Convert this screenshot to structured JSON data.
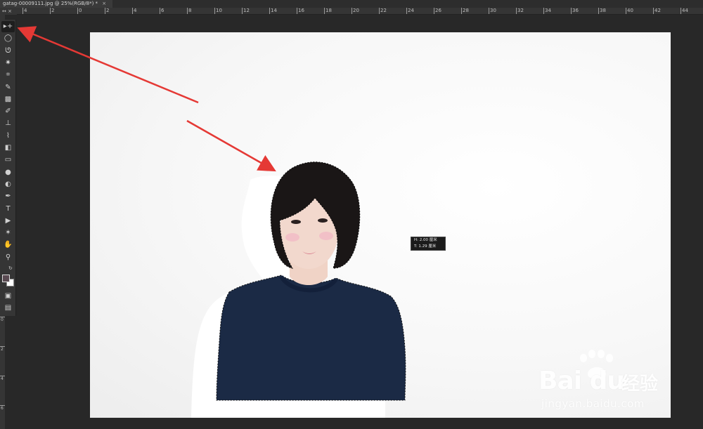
{
  "document": {
    "tab_title": "gatag-00009111.jpg @ 25%(RGB/8*) *",
    "close_glyph": "×"
  },
  "ruler": {
    "corner_label": "↔ ×",
    "h_labels": [
      "4",
      "2",
      "0",
      "2",
      "4",
      "6",
      "8",
      "10",
      "12",
      "14",
      "16",
      "18",
      "20",
      "22",
      "24",
      "26",
      "28",
      "30",
      "32",
      "34",
      "36",
      "38",
      "40",
      "42",
      "44"
    ],
    "v_labels": [
      "0",
      "2",
      "4",
      "6"
    ]
  },
  "toolbar": {
    "tools": [
      {
        "name": "move-tool-icon",
        "glyph": "▸+",
        "active": true
      },
      {
        "name": "elliptical-marquee-tool-icon",
        "glyph": "◯"
      },
      {
        "name": "lasso-tool-icon",
        "glyph": "ᘎ"
      },
      {
        "name": "magic-wand-tool-icon",
        "glyph": "✷"
      },
      {
        "name": "crop-tool-icon",
        "glyph": "⌗"
      },
      {
        "name": "eyedropper-tool-icon",
        "glyph": "✎"
      },
      {
        "name": "spot-healing-tool-icon",
        "glyph": "▩"
      },
      {
        "name": "brush-tool-icon",
        "glyph": "✐"
      },
      {
        "name": "clone-stamp-tool-icon",
        "glyph": "⊥"
      },
      {
        "name": "history-brush-tool-icon",
        "glyph": "⌇"
      },
      {
        "name": "eraser-tool-icon",
        "glyph": "◧"
      },
      {
        "name": "gradient-tool-icon",
        "glyph": "▭"
      },
      {
        "name": "blur-tool-icon",
        "glyph": "●"
      },
      {
        "name": "dodge-tool-icon",
        "glyph": "◐"
      },
      {
        "name": "pen-tool-icon",
        "glyph": "✒"
      },
      {
        "name": "type-tool-icon",
        "glyph": "T"
      },
      {
        "name": "path-selection-tool-icon",
        "glyph": "▶"
      },
      {
        "name": "custom-shape-tool-icon",
        "glyph": "✶"
      },
      {
        "name": "hand-tool-icon",
        "glyph": "✋"
      },
      {
        "name": "zoom-tool-icon",
        "glyph": "⚲"
      }
    ],
    "swatch_glyph": "↻",
    "quick_mask_glyph": "▣",
    "screen_mode_glyph": "▤",
    "foreground_color": "#5a4a52",
    "background_color": "#ffffff"
  },
  "canvas": {
    "measure_line_1": "H: 2.00 厘米",
    "measure_line_2": "T: 1.29 厘米"
  },
  "watermark": {
    "brand": "Bai du",
    "paw_icon": "paw-icon",
    "cn_text": "经验",
    "url": "jingyan.baidu.com"
  },
  "colors": {
    "app_background": "#282828",
    "panel": "#353535",
    "arrow": "#e53935",
    "sweater": "#1b2a45",
    "hair": "#1a1616",
    "skin": "#f1d6cb"
  }
}
